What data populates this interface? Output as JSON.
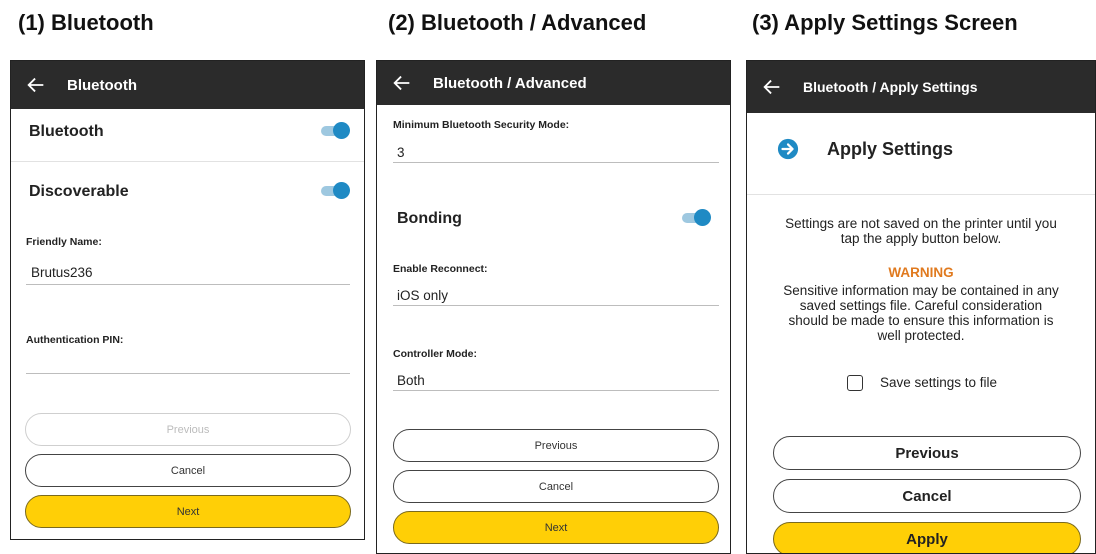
{
  "captions": {
    "p1": "(1) Bluetooth",
    "p2": "(2) Bluetooth / Advanced",
    "p3": "(3) Apply Settings Screen"
  },
  "icons": {
    "back": "back-arrow-icon",
    "apply": "arrow-right-circle-icon"
  },
  "colors": {
    "appbar": "#2b2b2b",
    "toggle": "#1f8ac4",
    "primary": "#ffcf06",
    "warning": "#e07a1f"
  },
  "panel1": {
    "title": "Bluetooth",
    "bluetooth_label": "Bluetooth",
    "bluetooth_on": true,
    "discoverable_label": "Discoverable",
    "discoverable_on": true,
    "friendly_name_label": "Friendly Name:",
    "friendly_name_value": "Brutus236",
    "auth_pin_label": "Authentication PIN:",
    "auth_pin_value": "",
    "previous": "Previous",
    "cancel": "Cancel",
    "next": "Next"
  },
  "panel2": {
    "title": "Bluetooth / Advanced",
    "security_mode_label": "Minimum Bluetooth Security Mode:",
    "security_mode_value": "3",
    "bonding_label": "Bonding",
    "bonding_on": true,
    "reconnect_label": "Enable Reconnect:",
    "reconnect_value": "iOS only",
    "controller_label": "Controller Mode:",
    "controller_value": "Both",
    "previous": "Previous",
    "cancel": "Cancel",
    "next": "Next"
  },
  "panel3": {
    "title": "Bluetooth / Apply Settings",
    "heading": "Apply Settings",
    "notice_line1": "Settings are not saved on the printer until you",
    "notice_line2": "tap the apply button below.",
    "warning_title": "WARNING",
    "warning_line1": "Sensitive information may be contained in any",
    "warning_line2": "saved settings file. Careful consideration",
    "warning_line3": "should be made to ensure this information is",
    "warning_line4": "well protected.",
    "save_checkbox_label": "Save settings to file",
    "save_checked": false,
    "previous": "Previous",
    "cancel": "Cancel",
    "apply": "Apply"
  }
}
